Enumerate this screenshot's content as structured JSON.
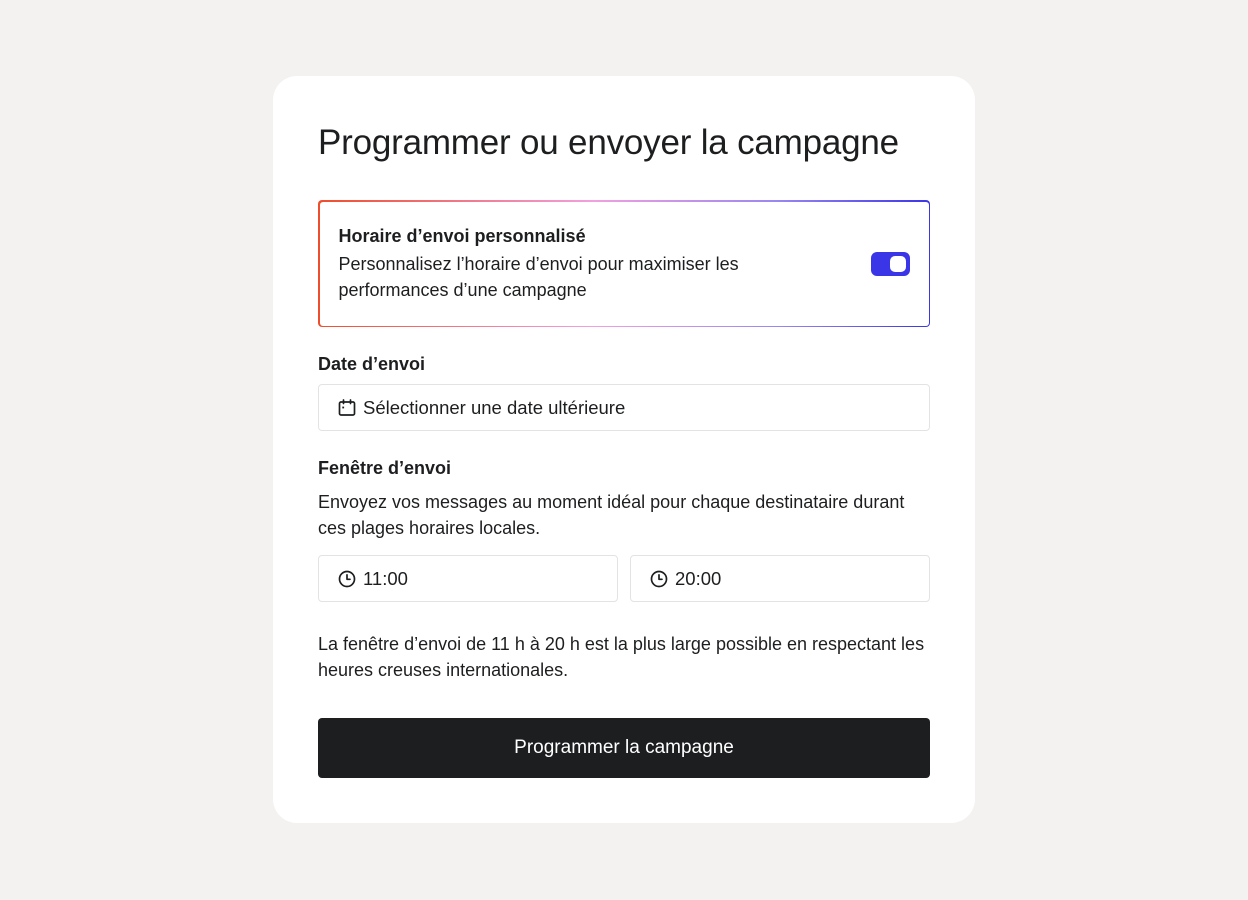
{
  "title": "Programmer ou envoyer la campagne",
  "custom_schedule": {
    "title": "Horaire d’envoi personnalisé",
    "description": "Personnalisez l’horaire d’envoi pour maximiser les performances d’une campagne",
    "enabled": true
  },
  "send_date": {
    "label": "Date d’envoi",
    "placeholder": "Sélectionner une date ultérieure",
    "icon": "calendar-icon"
  },
  "send_window": {
    "label": "Fenêtre d’envoi",
    "description": "Envoyez vos messages au moment idéal pour chaque destinataire durant ces plages horaires locales.",
    "start_time": "11:00",
    "end_time": "20:00",
    "icon": "clock-icon",
    "note": "La fenêtre d’envoi de 11 h à 20 h est la plus large possible en respectant les heures creuses internationales."
  },
  "submit_label": "Programmer la campagne",
  "colors": {
    "background": "#f3f2f0",
    "card": "#ffffff",
    "accent": "#3b35e8",
    "gradient_start": "#ef4e2b",
    "gradient_end": "#3b35e8",
    "button": "#1d1e20"
  }
}
